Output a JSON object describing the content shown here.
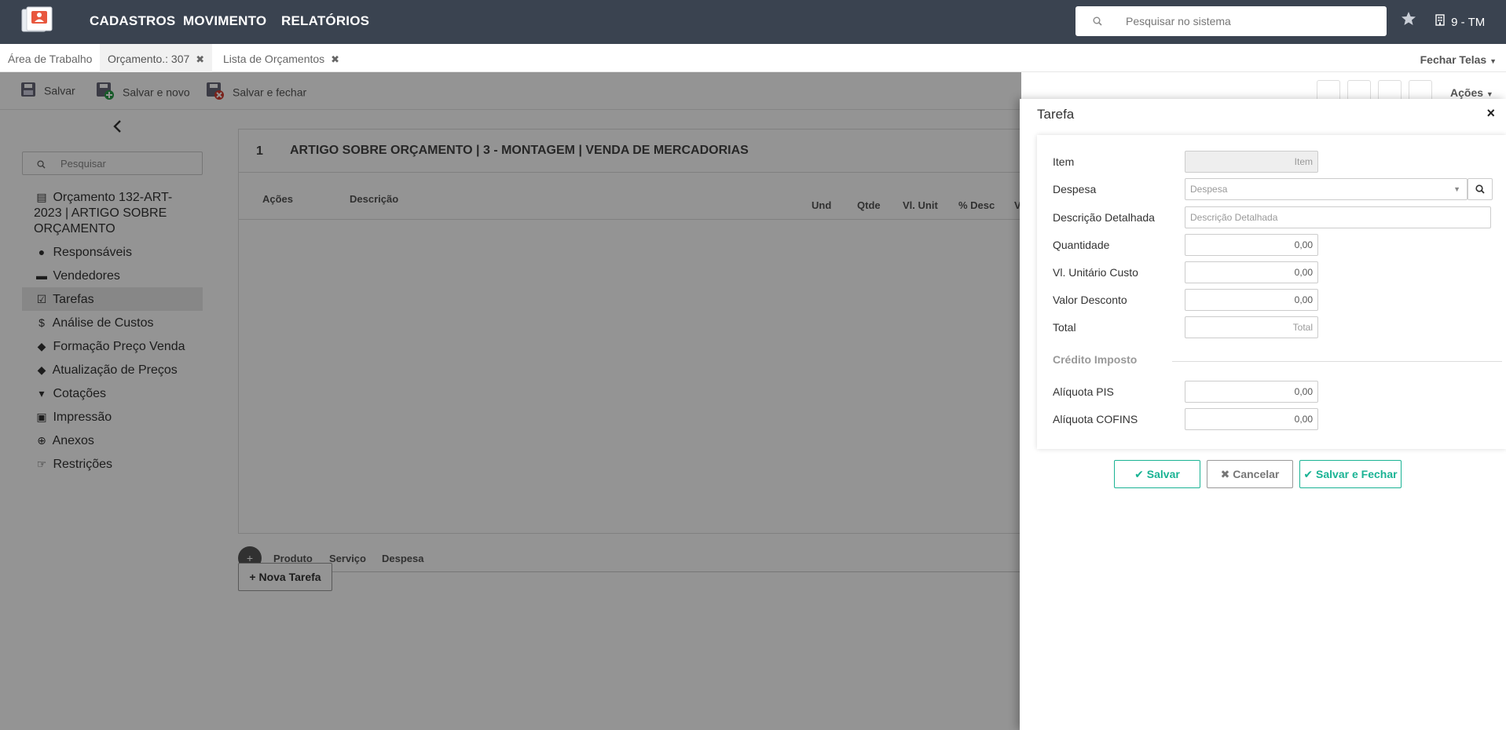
{
  "app": {
    "nav": [
      "CADASTROS",
      "MOVIMENTO",
      "RELATÓRIOS"
    ],
    "search_placeholder": "Pesquisar no sistema",
    "company": "9 - TM"
  },
  "tabs": {
    "items": [
      {
        "label": "Área de Trabalho"
      },
      {
        "label": "Orçamento.: 307"
      },
      {
        "label": "Lista de Orçamentos"
      }
    ],
    "close_all": "Fechar Telas"
  },
  "toolbar": {
    "save": "Salvar",
    "save_new": "Salvar e novo",
    "save_close": "Salvar e fechar",
    "actions": "Ações"
  },
  "sidebar": {
    "search_placeholder": "Pesquisar",
    "items": [
      {
        "label": "Orçamento 132-ART-2023 | ARTIGO SOBRE ORÇAMENTO",
        "icon": "calculator-icon"
      },
      {
        "label": "Responsáveis",
        "icon": "user-icon"
      },
      {
        "label": "Vendedores",
        "icon": "briefcase-icon"
      },
      {
        "label": "Tarefas",
        "icon": "check-square-icon"
      },
      {
        "label": "Análise de Custos",
        "icon": "dollar-icon"
      },
      {
        "label": "Formação Preço Venda",
        "icon": "tags-icon"
      },
      {
        "label": "Atualização de Preços",
        "icon": "tags-icon"
      },
      {
        "label": "Cotações",
        "icon": "cart-icon"
      },
      {
        "label": "Impressão",
        "icon": "print-icon"
      },
      {
        "label": "Anexos",
        "icon": "download-icon"
      },
      {
        "label": "Restrições",
        "icon": "hand-icon"
      }
    ]
  },
  "main": {
    "task_number": "1",
    "task_title": "ARTIGO SOBRE ORÇAMENTO | 3 - MONTAGEM | VENDA DE MERCADORIAS",
    "columns": [
      "Ações",
      "Descrição",
      "Und",
      "Qtde",
      "Vl. Unit",
      "% Desc",
      "V"
    ],
    "add_options": [
      "Produto",
      "Serviço",
      "Despesa"
    ],
    "new_task": "Nova Tarefa"
  },
  "panel": {
    "title": "Tarefa",
    "fields": {
      "item": {
        "label": "Item",
        "placeholder": "Item"
      },
      "despesa": {
        "label": "Despesa",
        "placeholder": "Despesa"
      },
      "descricao": {
        "label": "Descrição Detalhada",
        "placeholder": "Descrição Detalhada"
      },
      "quantidade": {
        "label": "Quantidade",
        "value": "0,00"
      },
      "vl_unitario": {
        "label": "Vl. Unitário Custo",
        "value": "0,00"
      },
      "valor_desconto": {
        "label": "Valor Desconto",
        "value": "0,00"
      },
      "total": {
        "label": "Total",
        "placeholder": "Total"
      },
      "credito_section": "Crédito Imposto",
      "aliquota_pis": {
        "label": "Alíquota PIS",
        "value": "0,00"
      },
      "aliquota_cofins": {
        "label": "Alíquota COFINS",
        "value": "0,00"
      }
    },
    "buttons": {
      "save": "Salvar",
      "cancel": "Cancelar",
      "save_close": "Salvar e Fechar"
    }
  },
  "colors": {
    "topbar": "#3a4350",
    "accent": "#1ab394"
  }
}
